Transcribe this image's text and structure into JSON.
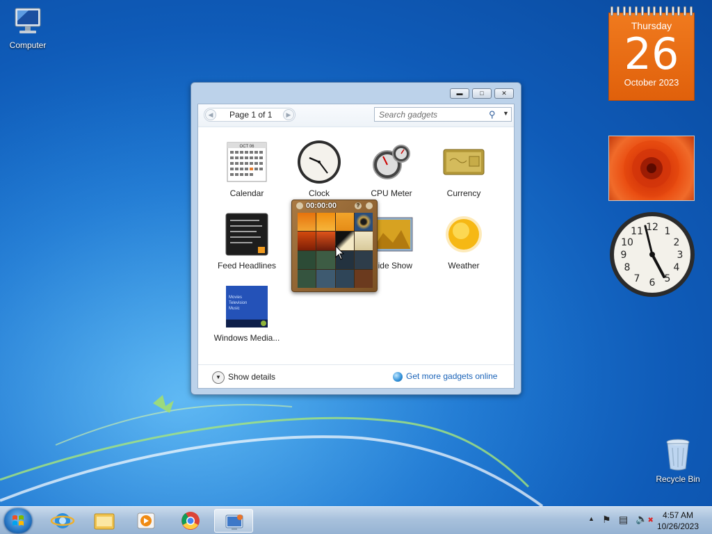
{
  "desktop": {
    "icons": [
      {
        "label": "Computer"
      },
      {
        "label": "Recycle Bin"
      }
    ]
  },
  "calendar_gadget": {
    "weekday": "Thursday",
    "day": "26",
    "month_year": "October 2023"
  },
  "window": {
    "pager_label": "Page 1 of 1",
    "search_placeholder": "Search gadgets",
    "gadgets": [
      {
        "label": "Calendar"
      },
      {
        "label": "Clock"
      },
      {
        "label": "CPU Meter"
      },
      {
        "label": "Currency"
      },
      {
        "label": "Feed Headlines"
      },
      {
        "label": "Slide Show"
      },
      {
        "label": "Weather"
      },
      {
        "label": "Windows Media..."
      }
    ],
    "mini_calendar_header": "OCT 06",
    "media_menu": [
      "Movies",
      "Television",
      "Music"
    ],
    "show_details": "Show details",
    "get_more": "Get more gadgets online"
  },
  "puzzle_gadget": {
    "timer": "00:00:00"
  },
  "taskbar": {
    "time": "4:57 AM",
    "date": "10/26/2023",
    "apps": [
      "internet-explorer-icon",
      "file-explorer-icon",
      "media-player-icon",
      "chrome-icon",
      "gadgets-icon"
    ]
  },
  "colors": {
    "calendar_orange": "#e96a14",
    "desktop_blue": "#1e78d2"
  }
}
